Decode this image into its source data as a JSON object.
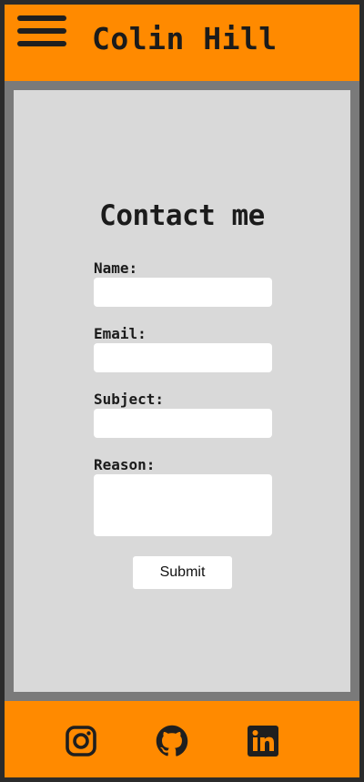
{
  "header": {
    "title": "Colin Hill",
    "menu_icon": "hamburger-menu-icon"
  },
  "contact": {
    "heading": "Contact me",
    "fields": [
      {
        "label": "Name:",
        "value": "",
        "placeholder": ""
      },
      {
        "label": "Email:",
        "value": "",
        "placeholder": ""
      },
      {
        "label": "Subject:",
        "value": "",
        "placeholder": ""
      },
      {
        "label": "Reason:",
        "value": "",
        "placeholder": ""
      }
    ],
    "submit_label": "Submit"
  },
  "footer": {
    "social_icons": [
      "instagram-icon",
      "github-icon",
      "linkedin-icon"
    ]
  },
  "colors": {
    "accent": "#ff8a00",
    "content_background": "#d9d9d9",
    "frame": "#7a7a7a",
    "text": "#1b1b1b"
  }
}
